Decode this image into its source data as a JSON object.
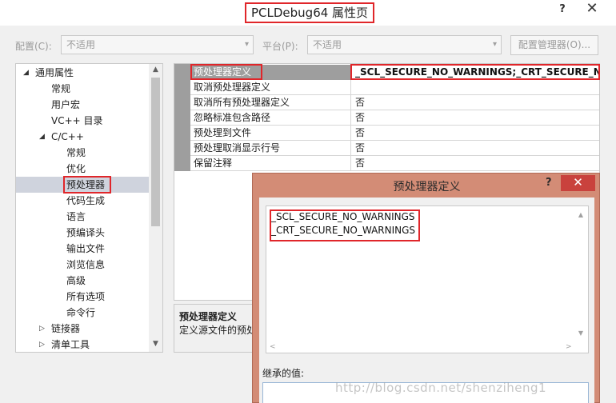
{
  "window": {
    "title": "PCLDebug64 属性页",
    "help": "?",
    "close": "✕"
  },
  "toolbar": {
    "config_label": "配置(C):",
    "config_value": "不适用",
    "platform_label": "平台(P):",
    "platform_value": "不适用",
    "config_manager": "配置管理器(O)..."
  },
  "tree": {
    "items": [
      {
        "label": "通用属性",
        "toggle": "◢"
      },
      {
        "label": "常规"
      },
      {
        "label": "用户宏"
      },
      {
        "label": "VC++ 目录"
      },
      {
        "label": "C/C++",
        "toggle": "◢"
      },
      {
        "label": "常规"
      },
      {
        "label": "优化"
      },
      {
        "label": "预处理器"
      },
      {
        "label": "代码生成"
      },
      {
        "label": "语言"
      },
      {
        "label": "预编译头"
      },
      {
        "label": "输出文件"
      },
      {
        "label": "浏览信息"
      },
      {
        "label": "高级"
      },
      {
        "label": "所有选项"
      },
      {
        "label": "命令行"
      },
      {
        "label": "链接器",
        "toggle": "▷"
      },
      {
        "label": "清单工具",
        "toggle": "▷"
      }
    ],
    "selected": "预处理器"
  },
  "grid": {
    "rows": [
      {
        "name": "预处理器定义",
        "value": "_SCL_SECURE_NO_WARNINGS;_CRT_SECURE_NO_WA"
      },
      {
        "name": "取消预处理器定义",
        "value": ""
      },
      {
        "name": "取消所有预处理器定义",
        "value": "否"
      },
      {
        "name": "忽略标准包含路径",
        "value": "否"
      },
      {
        "name": "预处理到文件",
        "value": "否"
      },
      {
        "name": "预处理取消显示行号",
        "value": "否"
      },
      {
        "name": "保留注释",
        "value": "否"
      }
    ]
  },
  "description": {
    "title": "预处理器定义",
    "text": "定义源文件的预处"
  },
  "dialog": {
    "title": "预处理器定义",
    "help": "?",
    "close": "✕",
    "definitions": [
      "_SCL_SECURE_NO_WARNINGS",
      "_CRT_SECURE_NO_WARNINGS"
    ],
    "inherited_label": "继承的值:"
  },
  "watermark": "http://blog.csdn.net/shenziheng1"
}
